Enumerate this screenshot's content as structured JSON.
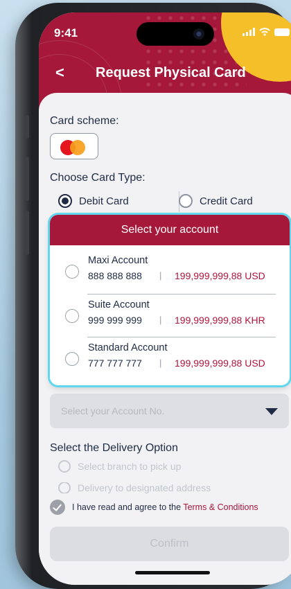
{
  "status_bar": {
    "time": "9:41"
  },
  "header": {
    "back_glyph": "<",
    "title": "Request Physical Card"
  },
  "form": {
    "card_scheme_label": "Card scheme:",
    "card_type_label": "Choose Card Type:",
    "card_types": [
      {
        "label": "Debit Card",
        "selected": true
      },
      {
        "label": "Credit Card",
        "selected": false
      }
    ],
    "account_placeholder": "Select your Account No.",
    "delivery_label": "Select the Delivery Option",
    "delivery_options": [
      "Select branch to pick up",
      "Delivery to designated address"
    ],
    "agree_text": "I have read and agree to the ",
    "terms_link": "Terms & Conditions",
    "confirm_label": "Confirm"
  },
  "account_sheet": {
    "title": "Select your account",
    "accounts": [
      {
        "name": "Maxi Account",
        "number": "888 888 888",
        "balance": "199,999,999,88 USD"
      },
      {
        "name": "Suite Account",
        "number": "999 999 999",
        "balance": "199,999,999,88 KHR"
      },
      {
        "name": "Standard Account",
        "number": "777 777 777",
        "balance": "199,999,999,88 USD"
      }
    ],
    "separator": "|"
  },
  "colors": {
    "brand": "#a5183a",
    "accent": "#f5bf2a",
    "highlight": "#5fd8ef",
    "text": "#1f2a44"
  }
}
